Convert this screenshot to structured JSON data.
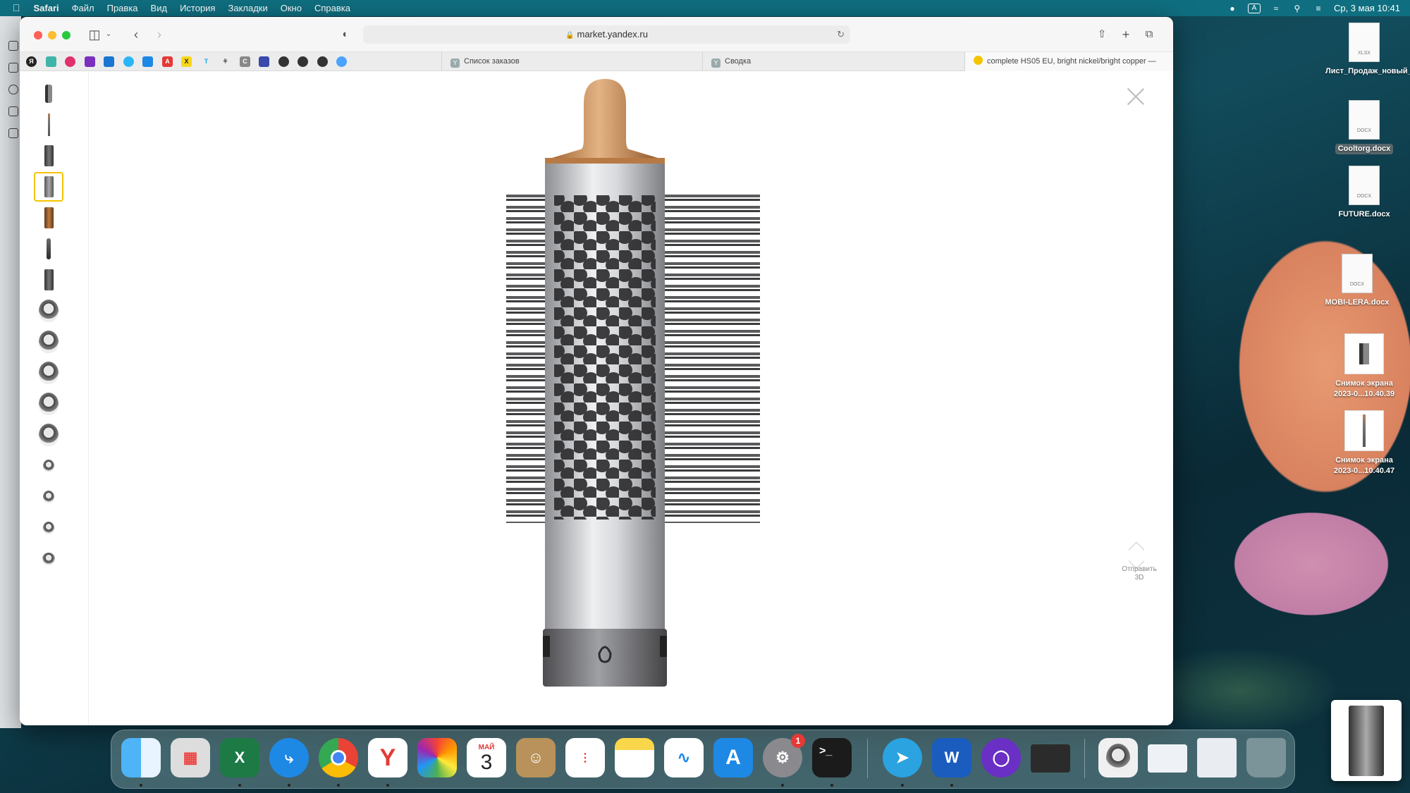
{
  "menubar": {
    "apple": "",
    "app": "Safari",
    "items": [
      "Файл",
      "Правка",
      "Вид",
      "История",
      "Закладки",
      "Окно",
      "Справка"
    ],
    "input_indicator": "A",
    "datetime": "Ср, 3 мая 10:41"
  },
  "browser": {
    "url": "market.yandex.ru",
    "tabs": [
      {
        "icon": "Y",
        "label": "Список заказов"
      },
      {
        "icon": "Y",
        "label": "Сводка"
      },
      {
        "icon": "",
        "label": "complete HS05 EU, bright nickel/bright copper — куп..."
      }
    ]
  },
  "viewer": {
    "send_3d": "Отправить 3D"
  },
  "desktop_icons": [
    {
      "type": "XLSX",
      "label": "Лист_Продаж_новый_Ав...ный.xlsx"
    },
    {
      "type": "DOCX",
      "label": "Cooltorg.docx"
    },
    {
      "type": "DOCX",
      "label": "FUTURE.docx"
    },
    {
      "type": "DOCX",
      "label": "MOBI-LERA.docx"
    },
    {
      "type": "",
      "label": "Снимок экрана 2023-0...10.40.39"
    },
    {
      "type": "",
      "label": "Снимок экрана 2023-0...10.40.47"
    }
  ],
  "dock": {
    "calendar_month": "МАЙ",
    "calendar_day": "3",
    "settings_badge": "1",
    "terminal": ">_"
  },
  "colors": {
    "menubar": "#0f6f80",
    "thumb_selected": "#f5c400",
    "copper": "#c98b55"
  }
}
